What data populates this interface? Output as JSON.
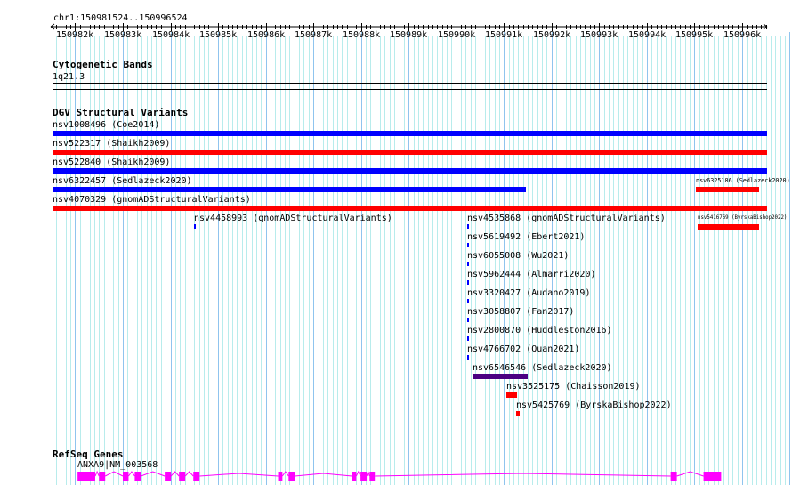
{
  "location": "chr1:150981524..150996524",
  "ruler": {
    "start": 150981524,
    "end": 150996524,
    "ticks": [
      "150982k",
      "150983k",
      "150984k",
      "150985k",
      "150986k",
      "150987k",
      "150988k",
      "150989k",
      "150990k",
      "150991k",
      "150992k",
      "150993k",
      "150994k",
      "150995k",
      "150996k"
    ]
  },
  "cytobands": {
    "title": "Cytogenetic Bands",
    "band": "1q21.3"
  },
  "dgv": {
    "title": "DGV Structural Variants",
    "colors": {
      "loss": "#0000ff",
      "gain": "#ff0000",
      "complex": "#4b0082"
    },
    "features": [
      {
        "id": "nsv1008496",
        "label": "nsv1008496 (Coe2014)",
        "start": 150981524,
        "end": 150996524,
        "color": "#0000ff",
        "row": 0
      },
      {
        "id": "nsv522317",
        "label": "nsv522317 (Shaikh2009)",
        "start": 150981524,
        "end": 150996524,
        "color": "#ff0000",
        "row": 1
      },
      {
        "id": "nsv522840",
        "label": "nsv522840 (Shaikh2009)",
        "start": 150981524,
        "end": 150996524,
        "color": "#0000ff",
        "row": 2
      },
      {
        "id": "nsv6322457",
        "label": "nsv6322457 (Sedlazeck2020)",
        "start": 150981524,
        "end": 150991460,
        "color": "#0000ff",
        "row": 3
      },
      {
        "id": "nsv6325186",
        "label": "nsv6325186 (Sedlazeck2020)",
        "start": 150995025,
        "end": 150996360,
        "color": "#ff0000",
        "row": 3
      },
      {
        "id": "nsv4070329",
        "label": "nsv4070329 (gnomADStructuralVariants)",
        "start": 150981524,
        "end": 150996524,
        "color": "#ff0000",
        "row": 4
      },
      {
        "id": "nsv4458993",
        "label": "nsv4458993 (gnomADStructuralVariants)",
        "start": 150984500,
        "end": 150984530,
        "color": "#0000ff",
        "row": 5
      },
      {
        "id": "nsv4535868",
        "label": "nsv4535868 (gnomADStructuralVariants)",
        "start": 150990220,
        "end": 150990250,
        "color": "#0000ff",
        "row": 5
      },
      {
        "id": "nsv5416769",
        "label": "nsv5416769 (ByrskaBishop2022)",
        "start": 150995060,
        "end": 150996360,
        "color": "#ff0000",
        "row": 5
      },
      {
        "id": "nsv5619492",
        "label": "nsv5619492 (Ebert2021)",
        "start": 150990220,
        "end": 150990250,
        "color": "#0000ff",
        "row": 6
      },
      {
        "id": "nsv6055008",
        "label": "nsv6055008 (Wu2021)",
        "start": 150990220,
        "end": 150990250,
        "color": "#0000ff",
        "row": 7
      },
      {
        "id": "nsv5962444",
        "label": "nsv5962444 (Almarri2020)",
        "start": 150990220,
        "end": 150990250,
        "color": "#0000ff",
        "row": 8
      },
      {
        "id": "nsv3320427",
        "label": "nsv3320427 (Audano2019)",
        "start": 150990220,
        "end": 150990250,
        "color": "#0000ff",
        "row": 9
      },
      {
        "id": "nsv3058807",
        "label": "nsv3058807 (Fan2017)",
        "start": 150990220,
        "end": 150990250,
        "color": "#0000ff",
        "row": 10
      },
      {
        "id": "nsv2800870",
        "label": "nsv2800870 (Huddleston2016)",
        "start": 150990220,
        "end": 150990250,
        "color": "#0000ff",
        "row": 11
      },
      {
        "id": "nsv4766702",
        "label": "nsv4766702 (Quan2021)",
        "start": 150990220,
        "end": 150990250,
        "color": "#0000ff",
        "row": 12
      },
      {
        "id": "nsv6546546",
        "label": "nsv6546546 (Sedlazeck2020)",
        "start": 150990350,
        "end": 150991500,
        "color": "#4b0082",
        "row": 13
      },
      {
        "id": "nsv3525175",
        "label": "nsv3525175 (Chaisson2019)",
        "start": 150991060,
        "end": 150991280,
        "color": "#ff0000",
        "row": 14
      },
      {
        "id": "nsv5425769",
        "label": "nsv5425769 (ByrskaBishop2022)",
        "start": 150991250,
        "end": 150991330,
        "color": "#ff0000",
        "row": 15
      }
    ]
  },
  "refseq": {
    "title": "RefSeq Genes",
    "gene_label": "ANXA9|NM_003568",
    "color": "#ff00ff",
    "exons": [
      [
        150982050,
        150982420
      ],
      [
        150982500,
        150982630
      ],
      [
        150983000,
        150983120
      ],
      [
        150983250,
        150983380
      ],
      [
        150983880,
        150984010
      ],
      [
        150984180,
        150984310
      ],
      [
        150984480,
        150984610
      ],
      [
        150986260,
        150986350
      ],
      [
        150986480,
        150986610
      ],
      [
        150987810,
        150987900
      ],
      [
        150987990,
        150988120
      ],
      [
        150988180,
        150988290
      ],
      [
        150994500,
        150994630
      ],
      [
        150995190,
        150995560
      ]
    ]
  }
}
